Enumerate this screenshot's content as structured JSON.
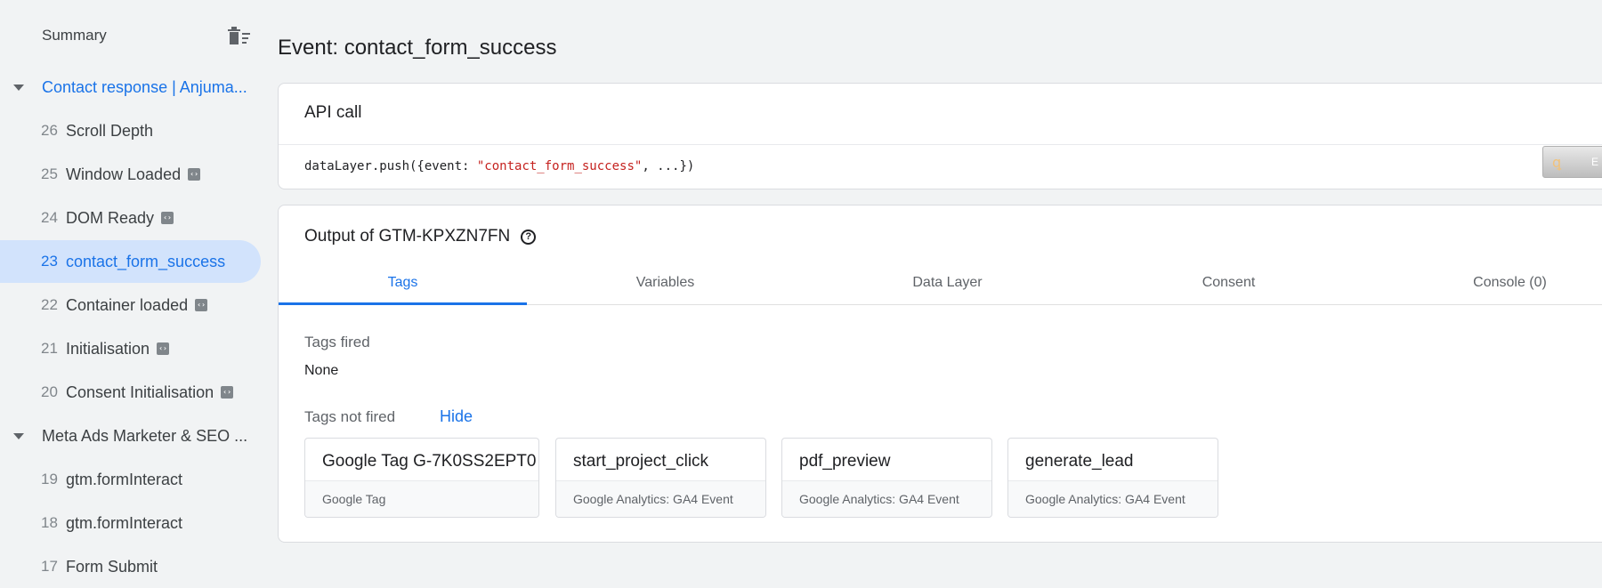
{
  "sidebar": {
    "summary_label": "Summary",
    "groups": [
      {
        "label": "Contact response | Anjuma...",
        "items": [
          {
            "num": "26",
            "label": "Scroll Depth",
            "has_badge": false
          },
          {
            "num": "25",
            "label": "Window Loaded",
            "has_badge": true
          },
          {
            "num": "24",
            "label": "DOM Ready",
            "has_badge": true
          },
          {
            "num": "23",
            "label": "contact_form_success",
            "has_badge": false,
            "selected": true
          },
          {
            "num": "22",
            "label": "Container loaded",
            "has_badge": true
          },
          {
            "num": "21",
            "label": "Initialisation",
            "has_badge": true
          },
          {
            "num": "20",
            "label": "Consent Initialisation",
            "has_badge": true
          }
        ]
      },
      {
        "label": "Meta Ads Marketer & SEO ...",
        "items": [
          {
            "num": "19",
            "label": "gtm.formInteract",
            "has_badge": false
          },
          {
            "num": "18",
            "label": "gtm.formInteract",
            "has_badge": false
          },
          {
            "num": "17",
            "label": "Form Submit",
            "has_badge": false
          }
        ]
      }
    ]
  },
  "main": {
    "title": "Event: contact_form_success",
    "api_call": {
      "title": "API call",
      "code_prefix": "dataLayer.push({event: ",
      "code_string": "\"contact_form_success\"",
      "code_suffix": ", ...})"
    },
    "side_tab": {
      "icon": "ꝗ",
      "text": "E"
    },
    "output": {
      "title": "Output of GTM-KPXZN7FN",
      "tabs": [
        "Tags",
        "Variables",
        "Data Layer",
        "Consent",
        "Console (0)"
      ],
      "active_tab": "Tags",
      "tags_fired_label": "Tags fired",
      "tags_fired_value": "None",
      "tags_not_fired_label": "Tags not fired",
      "hide_label": "Hide",
      "tags_not_fired": [
        {
          "name": "Google Tag G-7K0SS2EPT0",
          "type": "Google Tag"
        },
        {
          "name": "start_project_click",
          "type": "Google Analytics: GA4 Event"
        },
        {
          "name": "pdf_preview",
          "type": "Google Analytics: GA4 Event"
        },
        {
          "name": "generate_lead",
          "type": "Google Analytics: GA4 Event"
        }
      ]
    }
  },
  "colors": {
    "accent": "#1a73e8",
    "selected_bg": "#d2e3fc",
    "page_bg": "#f1f3f4",
    "code_string": "#c5221f"
  },
  "icons": {
    "trash": "trash-icon",
    "caret": "caret-down-icon",
    "badge": "code-badge-icon",
    "help": "help-circle-icon"
  }
}
